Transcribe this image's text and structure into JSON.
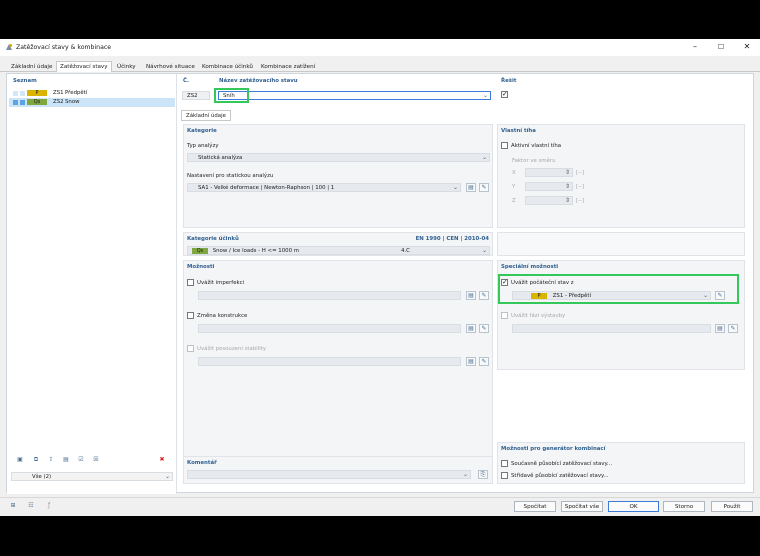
{
  "window": {
    "title": "Zatěžovací stavy & kombinace"
  },
  "tabs": [
    "Základní údaje",
    "Zatěžovací stavy",
    "Účinky",
    "Návrhové situace",
    "Kombinace účinků",
    "Kombinace zatížení"
  ],
  "list": {
    "header": "Seznam",
    "items": [
      {
        "code": "P",
        "id": "ZS1",
        "name": "Předpětí",
        "color": "#d9b400"
      },
      {
        "code": "Qs",
        "id": "ZS2",
        "name": "Snow",
        "color": "#7fa63f"
      }
    ],
    "filter": "Vše (2)"
  },
  "top": {
    "no_label": "Č.",
    "no_value": "ZS2",
    "name_label": "Název zatěžovacího stavu",
    "name_value": "Sníh",
    "solve_label": "Řešit"
  },
  "subtab": "Základní údaje",
  "category": {
    "header": "Kategorie",
    "analysis_label": "Typ analýzy",
    "analysis_value": "Statická analýza",
    "settings_label": "Nastavení pro statickou analýzu",
    "settings_value": "SA1 - Velké deformace | Newton-Raphson | 100 | 1"
  },
  "selfweight": {
    "header": "Vlastní tíha",
    "active_label": "Aktivní vlastní tíha",
    "factor_label": "Faktor ve směru",
    "axes": [
      "X",
      "Y",
      "Z"
    ],
    "unit": "[--]"
  },
  "effects": {
    "header": "Kategorie účinků",
    "norm": "EN 1990 | CEN | 2010-04",
    "code": "Qs",
    "value": "Snow / Ice loads - H <= 1000 m",
    "clause": "4.C"
  },
  "options": {
    "header": "Možnosti",
    "imperfection": "Uvážit imperfekci",
    "structure_change": "Změna konstrukce",
    "stability": "Uvážit posouzení stability"
  },
  "special": {
    "header": "Speciální možnosti",
    "initial_state": "Uvážit počáteční stav z",
    "initial_code": "P",
    "initial_value": "ZS1 - Předpětí",
    "phase": "Uvážit fázi výstavby"
  },
  "comment": {
    "header": "Komentář"
  },
  "generator": {
    "header": "Možnosti pro generátor kombinací",
    "simultaneous": "Současně působící zatěžovací stavy...",
    "alternating": "Střídavě působící zatěžovací stavy..."
  },
  "buttons": {
    "calc": "Spočítat",
    "calc_all": "Spočítat vše",
    "ok": "OK",
    "cancel": "Storno",
    "apply": "Použít"
  }
}
